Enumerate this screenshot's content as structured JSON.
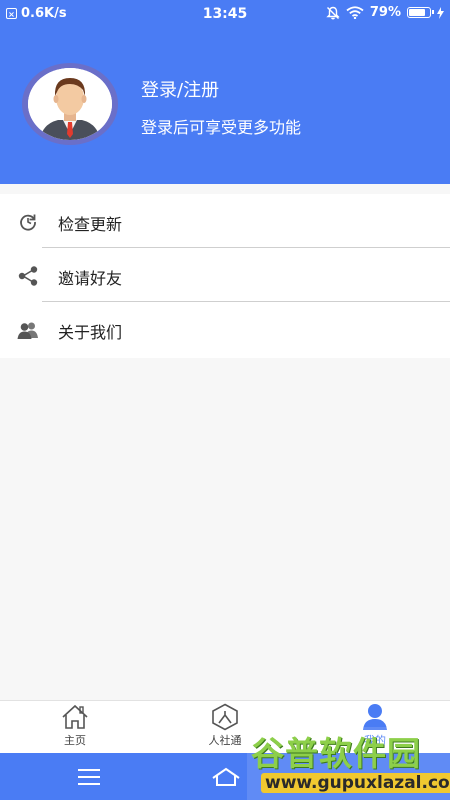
{
  "status_bar": {
    "net_speed": "0.6K/s",
    "time": "13:45",
    "battery": "79%",
    "battery_level": 0.79
  },
  "header": {
    "title": "登录/注册",
    "subtitle": "登录后可享受更多功能"
  },
  "menu": {
    "items": [
      {
        "label": "检查更新",
        "icon": "refresh-icon"
      },
      {
        "label": "邀请好友",
        "icon": "share-icon"
      },
      {
        "label": "关于我们",
        "icon": "users-icon"
      }
    ]
  },
  "tabs": [
    {
      "label": "主页",
      "icon": "home-icon"
    },
    {
      "label": "人社通",
      "icon": "hexagon-person-icon"
    },
    {
      "label": "我的",
      "icon": "person-icon",
      "active": true
    }
  ],
  "colors": {
    "primary": "#4a7cf4",
    "watermark_green": "#8dcf4a",
    "watermark_yellow": "#f0c830"
  },
  "watermark": {
    "title": "谷普软件园",
    "url": "www.gupuxlazal.com"
  }
}
